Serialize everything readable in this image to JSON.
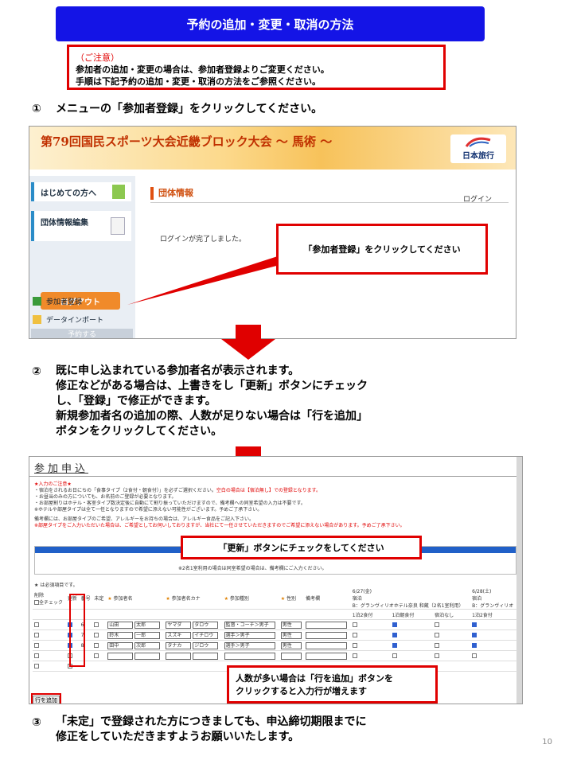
{
  "title": "予約の追加・変更・取消の方法",
  "notice": {
    "heading": "（ご注意）",
    "line1": "参加者の追加・変更の場合は、参加者登録よりご変更ください。",
    "line2": "手順は下記予約の追加・変更・取消の方法をご参照ください。"
  },
  "steps": [
    {
      "num": "①",
      "text": "メニューの「参加者登録」をクリックしてください。"
    },
    {
      "num": "②",
      "lines": [
        "既に申し込まれている参加者名が表示されます。",
        "修正などがある場合は、上書きをし「更新」ボタンにチェック",
        "し、「登録」で修正ができます。",
        "新規参加者名の追加の際、人数が足りない場合は「行を追加」",
        "ボタンをクリックしてください。"
      ]
    },
    {
      "num": "③",
      "lines": [
        "「未定」で登録された方につきましても、申込締切期限までに",
        "修正をしていただきますようお願いいたします。"
      ]
    }
  ],
  "screenshot1": {
    "banner_title": "第79回国民スポーツ大会近畿ブロック大会 〜 馬術 〜",
    "logo_text": "日本旅行",
    "sidebar": {
      "first_time": "はじめての方へ",
      "group_edit": "団体情報編集",
      "logout": "ログアウト",
      "reserve_head": "予約する",
      "participant_reg": "参加者登録",
      "data_import": "データインポート"
    },
    "main_heading": "団体情報",
    "login_link": "ログイン",
    "login_message": "ログインが完了しました。",
    "callout": "「参加者登録」をクリックしてください"
  },
  "screenshot2": {
    "heading": "参加申込",
    "notes_title": "★入力のご注意★",
    "notes": [
      "・宿泊をされるお日にちの「食事タイプ（2食付・朝食付）」を必ずご選択ください。",
      "・お昼当のみの方についても、お名前のご登録が必要となります。",
      "・お部屋割りはホテル・客室タイプ数決定後に自動にて割り振っていただけますので、備考欄への同室希望の入力は不要です。",
      "※ホテルや部屋タイプは全て一任となりますので希望に添えない可能性がございます。予めご了承下さい。",
      "備考欄には、お部屋タイプのご希望、アレルギーをお持ちの場合は、アレルギー食品をご記入下さい。"
    ],
    "notes_red1": "空白の場合は【宿泊無し】での登録となります。",
    "notes_red2": "※部屋タイプをご入力いただいた場合は、ご希望としてお伺いしておりますが、当社にて一任させていただきますのでご希望に添えない場合があります。予めご了承下さい。",
    "blue_box_text": "※2名1室利用の場合は同室希望の場合は、備考欄にご入力ください。",
    "required_note": "★ は必須項目です。",
    "columns": [
      "削除",
      "更新",
      "番号",
      "未定",
      "参加者名",
      "参加者名カナ",
      "参加種別",
      "性別",
      "備考欄",
      "6/27(金)",
      "6/28(土)"
    ],
    "delete_sub": "全チェック",
    "hotel_label": "B：グランヴィリオホテル奈良 和蔵（2名1室利用）",
    "hotel_label2": "B：グランヴィリオ",
    "lodging": "宿泊",
    "meal_options": [
      "1泊2食付",
      "1泊朝食付",
      "宿泊なし",
      "1泊2食付"
    ],
    "rows": [
      {
        "no": "6",
        "last": "山田",
        "first": "太郎",
        "last_kana": "ヤマダ",
        "first_kana": "タロウ",
        "type": "監督・コーチ＞男子",
        "sex": "男性"
      },
      {
        "no": "7",
        "last": "鈴木",
        "first": "一郎",
        "last_kana": "スズキ",
        "first_kana": "イチロウ",
        "type": "選手＞男子",
        "sex": "男性"
      },
      {
        "no": "8",
        "last": "田中",
        "first": "次郎",
        "last_kana": "タナカ",
        "first_kana": "ジロウ",
        "type": "選手＞男子",
        "sex": "男性"
      }
    ],
    "add_row_button": "行を追加",
    "callout_update": "「更新」ボタンにチェックをしてください",
    "callout_addrow_line1": "人数が多い場合は「行を追加」ボタンを",
    "callout_addrow_line2": "クリックすると入力行が増えます"
  },
  "page_number": "10",
  "colors": {
    "title_bg": "#1414e6",
    "accent_red": "#e00000"
  }
}
